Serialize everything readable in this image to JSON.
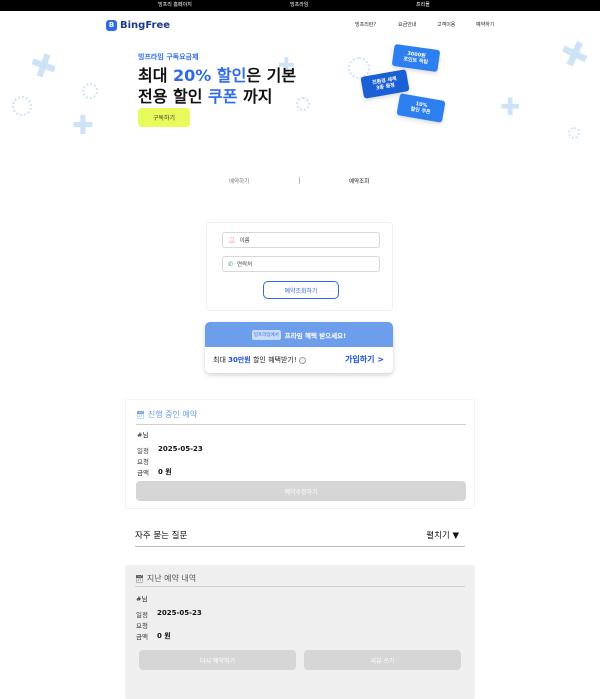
{
  "topbar": {
    "links": [
      "빙프리 홈페이지",
      "빙프라임",
      "프리몰"
    ]
  },
  "nav": {
    "logo_text": "BingFree",
    "logo_mark": "B",
    "links": [
      "빙프리란?",
      "요금안내",
      "고객이용",
      "예약하기"
    ]
  },
  "hero": {
    "subtitle": "빙프라임 구독요금제",
    "title_line1_pre": "최대 ",
    "title_line1_highlight": "20% 할인",
    "title_line1_post": "은 기본",
    "title_line2_pre": "전용 할인 ",
    "title_line2_highlight": "쿠폰",
    "title_line2_post": " 까지",
    "subscribe_button": "구독하기",
    "coupons": [
      {
        "line1": "3000원",
        "line2": "포인트 적립"
      },
      {
        "line1": "친환경 세제",
        "line2": "3종 증정"
      },
      {
        "line1": "10%",
        "line2": "할인 쿠폰"
      }
    ]
  },
  "tabs": {
    "reserve": "예약하기",
    "lookup": "예약조회"
  },
  "lookup_form": {
    "name_placeholder": "이름",
    "phone_placeholder": "연락처",
    "submit": "예약조회하기"
  },
  "promo": {
    "badge": "빙프라임에서",
    "headline": "프라임 혜택 받으세요!",
    "text_pre": "최대 ",
    "text_amount": "30만원",
    "text_post": " 할인 혜택받기!",
    "info": "i",
    "join": "가입하기 >"
  },
  "active": {
    "title": "진행 중인 예약",
    "user": "#님",
    "date_label": "일정",
    "date_value": "2025-05-23",
    "request_label": "요청",
    "amount_label": "금액",
    "amount_value": "0 원",
    "modify_button": "예약수정하기"
  },
  "faq": {
    "question": "자주 묻는 질문",
    "toggle": "펼치기 ▼"
  },
  "history": {
    "title": "지난 예약 내역",
    "user": "#님",
    "date_label": "일정",
    "date_value": "2025-05-23",
    "request_label": "요청",
    "amount_label": "금액",
    "amount_value": "0 원",
    "rebook_button": "다시 예약하기",
    "review_button": "리뷰 쓰기"
  },
  "colors": {
    "accent": "#2f6be8",
    "subscribe": "#e8fb5b",
    "promo_top": "#6d9eeb",
    "history_bg": "#efefef"
  }
}
